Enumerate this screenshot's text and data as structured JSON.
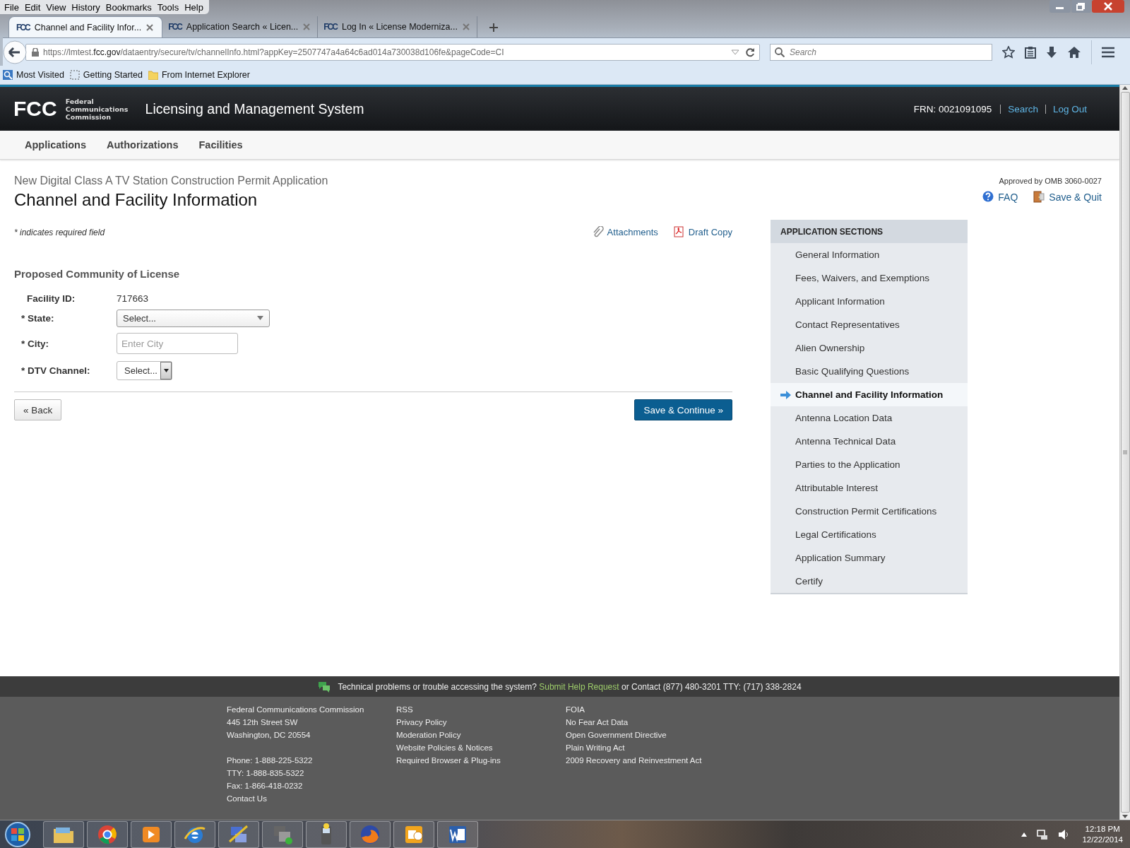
{
  "browser": {
    "menu": [
      "File",
      "Edit",
      "View",
      "History",
      "Bookmarks",
      "Tools",
      "Help"
    ],
    "tabs": [
      {
        "favicon": "FCC",
        "title": "Channel and Facility Infor...",
        "selected": true
      },
      {
        "favicon": "FCC",
        "title": "Application Search « Licen...",
        "selected": false
      },
      {
        "favicon": "FCC",
        "title": "Log In « License Moderniza...",
        "selected": false
      }
    ],
    "url": {
      "host_prefix": "https://lmtest.",
      "domain": "fcc.gov",
      "path": "/dataentry/secure/tv/channelInfo.html?appKey=2507747a4a64c6ad014a730038d106fe&pageCode=CI"
    },
    "search": {
      "placeholder": "Search"
    },
    "bookmarks": [
      {
        "kind": "globe",
        "label": "Most Visited"
      },
      {
        "kind": "dashed",
        "label": "Getting Started"
      },
      {
        "kind": "folder",
        "label": "From Internet Explorer"
      }
    ]
  },
  "header": {
    "logo_mark": "FCC",
    "agency": [
      "Federal",
      "Communications",
      "Commission"
    ],
    "title": "Licensing and Management System",
    "frn": "FRN: 0021091095",
    "links": [
      "Search",
      "Log Out"
    ]
  },
  "nav": [
    "Applications",
    "Authorizations",
    "Facilities"
  ],
  "page": {
    "subtitle": "New Digital Class A TV Station Construction Permit Application",
    "title": "Channel and Facility Information",
    "approval": "Approved by OMB 3060-0027",
    "actions": [
      {
        "kind": "help",
        "label": "FAQ"
      },
      {
        "kind": "exit",
        "label": "Save & Quit"
      }
    ],
    "required_note": "* indicates required field",
    "tools": [
      {
        "kind": "clip",
        "label": "Attachments"
      },
      {
        "kind": "pdf",
        "label": "Draft Copy"
      }
    ],
    "section_heading": "Proposed Community of License",
    "fields": [
      {
        "kind": "static",
        "label": "Facility ID:",
        "value": "717663"
      },
      {
        "kind": "select",
        "label": "* State:",
        "value": "Select..."
      },
      {
        "kind": "input",
        "label": "* City:",
        "placeholder": "Enter City"
      },
      {
        "kind": "spinner",
        "label": "* DTV Channel:",
        "value": "Select..."
      }
    ],
    "back": "« Back",
    "continue": "Save & Continue »"
  },
  "sections": {
    "heading": "APPLICATION SECTIONS",
    "items": [
      {
        "label": "General Information",
        "selected": false
      },
      {
        "label": "Fees, Waivers, and Exemptions",
        "selected": false
      },
      {
        "label": "Applicant Information",
        "selected": false
      },
      {
        "label": "Contact Representatives",
        "selected": false
      },
      {
        "label": "Alien Ownership",
        "selected": false
      },
      {
        "label": "Basic Qualifying Questions",
        "selected": false
      },
      {
        "label": "Channel and Facility Information",
        "selected": true
      },
      {
        "label": "Antenna Location Data",
        "selected": false
      },
      {
        "label": "Antenna Technical Data",
        "selected": false
      },
      {
        "label": "Parties to the Application",
        "selected": false
      },
      {
        "label": "Attributable Interest",
        "selected": false
      },
      {
        "label": "Construction Permit Certifications",
        "selected": false
      },
      {
        "label": "Legal Certifications",
        "selected": false
      },
      {
        "label": "Application Summary",
        "selected": false
      },
      {
        "label": "Certify",
        "selected": false
      }
    ]
  },
  "footer": {
    "help": {
      "text": "Technical problems or trouble accessing the system?",
      "link": "Submit Help Request",
      "contact": "or Contact (877) 480-3201 TTY: (717) 338-2824"
    },
    "columns": [
      [
        [
          "Federal Communications Commission",
          "445 12th Street SW",
          "Washington, DC 20554"
        ],
        [
          "Phone: 1-888-225-5322",
          "TTY: 1-888-835-5322",
          "Fax: 1-866-418-0232",
          "Contact Us"
        ]
      ],
      [
        [
          "RSS",
          "Privacy Policy",
          "Moderation Policy",
          "Website Policies & Notices",
          "Required Browser & Plug-ins"
        ]
      ],
      [
        [
          "FOIA",
          "No Fear Act Data",
          "Open Government Directive",
          "Plain Writing Act",
          "2009 Recovery and Reinvestment Act"
        ]
      ]
    ]
  },
  "taskbar": {
    "time": "12:18 PM",
    "date": "12/22/2014"
  }
}
